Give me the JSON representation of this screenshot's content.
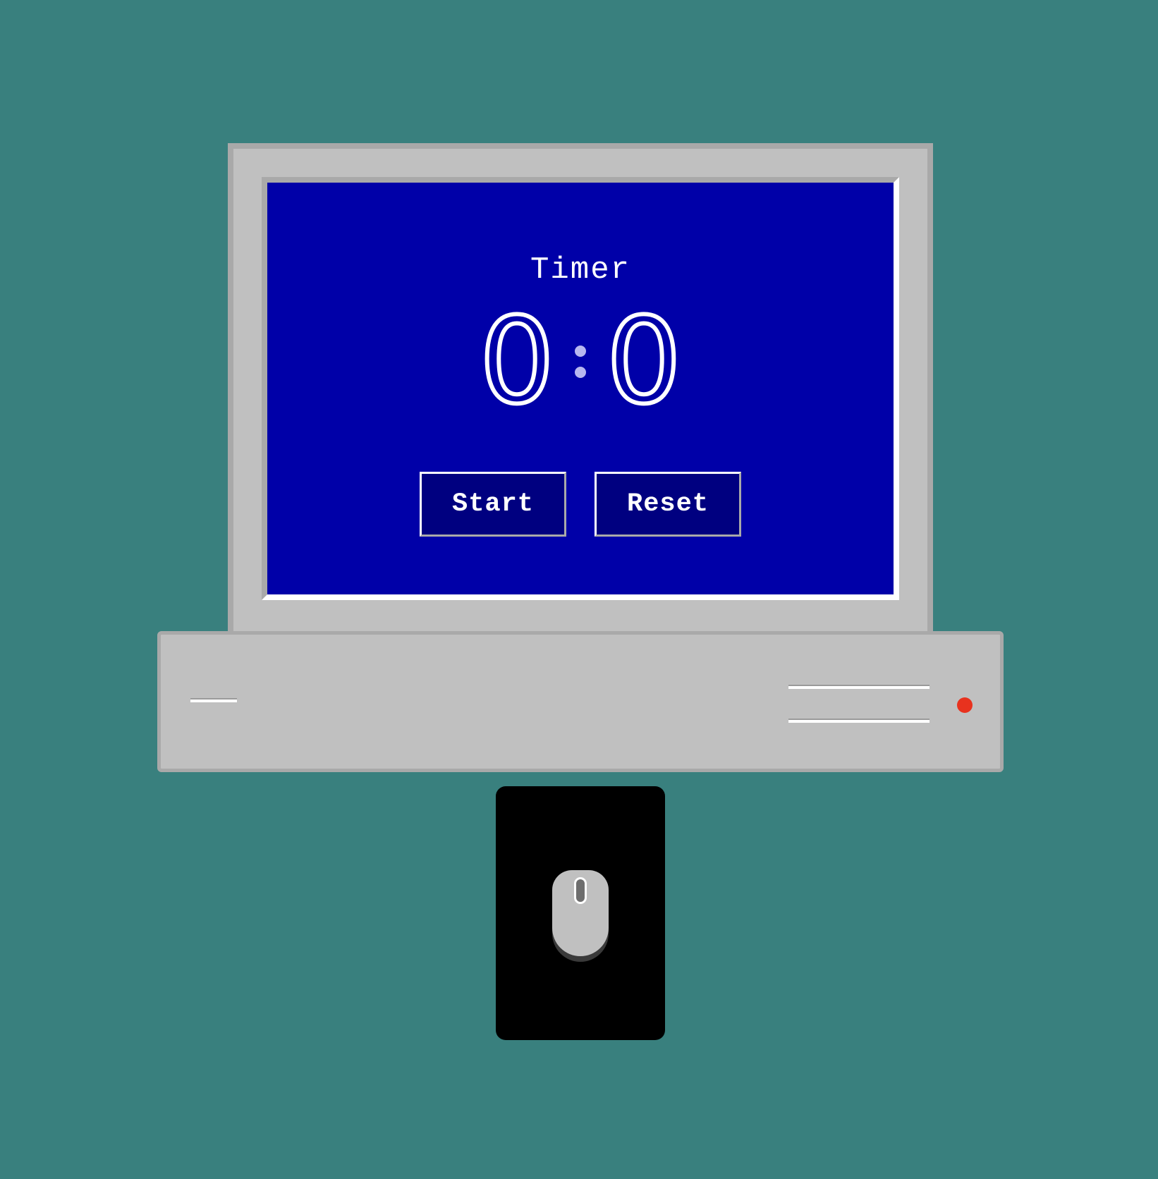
{
  "app": {
    "title": "Timer"
  },
  "clock": {
    "minutes": "0",
    "separator": ":",
    "seconds": "0"
  },
  "buttons": {
    "start_label": "Start",
    "reset_label": "Reset"
  },
  "colors": {
    "background": "#39807e",
    "screen": "#0000a8",
    "button": "#000080",
    "bezel": "#c0c0c0",
    "led": "#e8321e"
  },
  "icons": {
    "mouse": "computer-mouse-icon",
    "power_led": "power-led-indicator"
  }
}
